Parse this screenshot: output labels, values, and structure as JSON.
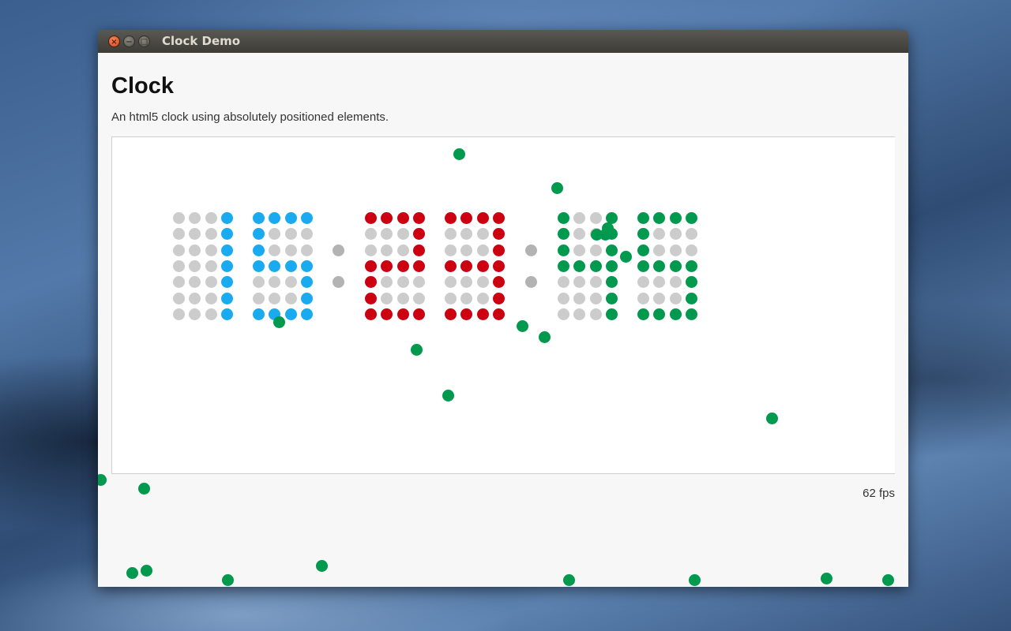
{
  "window": {
    "title": "Clock Demo",
    "close_glyph": "×",
    "min_glyph": "−",
    "max_glyph": "□"
  },
  "page": {
    "title": "Clock",
    "description": "An html5 clock using absolutely positioned elements.",
    "fps": "62 fps"
  },
  "clock": {
    "off_color": "#cccccc",
    "separator_color": "#b3b3b3",
    "digits": [
      {
        "color": "#19aaf0",
        "pattern": [
          "0001",
          "0001",
          "0001",
          "0001",
          "0001",
          "0001",
          "0001"
        ]
      },
      {
        "color": "#19aaf0",
        "pattern": [
          "1111",
          "1000",
          "1000",
          "1111",
          "0001",
          "0001",
          "1111"
        ]
      },
      {
        "color": "#cc0010",
        "pattern": [
          "1111",
          "0001",
          "0001",
          "1111",
          "1000",
          "1000",
          "1111"
        ]
      },
      {
        "color": "#cc0010",
        "pattern": [
          "1111",
          "0001",
          "0001",
          "1111",
          "0001",
          "0001",
          "1111"
        ]
      },
      {
        "color": "#00994d",
        "pattern": [
          "1001",
          "1001",
          "1001",
          "1111",
          "0001",
          "0001",
          "0001"
        ]
      },
      {
        "color": "#00994d",
        "pattern": [
          "1111",
          "1000",
          "1000",
          "1111",
          "0001",
          "0001",
          "1111"
        ]
      }
    ]
  },
  "balls": {
    "color": "#00994d"
  }
}
